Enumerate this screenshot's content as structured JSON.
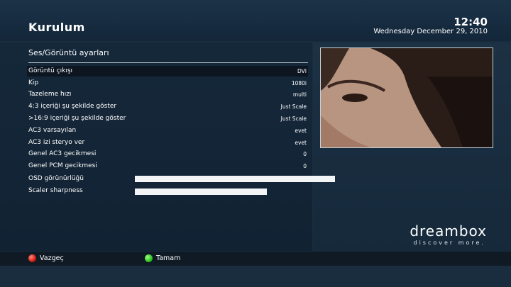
{
  "header": {
    "title": "Kurulum",
    "time": "12:40",
    "date": "Wednesday December 29, 2010"
  },
  "menu": {
    "title": "Ses/Görüntü ayarları",
    "rows": [
      {
        "label": "Görüntü çıkışı",
        "value": "DVI"
      },
      {
        "label": "Kip",
        "value": "1080i"
      },
      {
        "label": "Tazeleme hızı",
        "value": "multi"
      },
      {
        "label": "4:3 içeriği şu şekilde göster",
        "value": "Just Scale"
      },
      {
        "label": ">16:9 içeriği şu şekilde göster",
        "value": "Just Scale"
      },
      {
        "label": "AC3 varsayılan",
        "value": "evet"
      },
      {
        "label": "AC3 izi steryo ver",
        "value": "evet"
      },
      {
        "label": "Genel AC3 gecikmesi",
        "value": "0"
      },
      {
        "label": "Genel PCM gecikmesi",
        "value": "0"
      }
    ],
    "sliders": [
      {
        "label": "OSD görünürlüğü",
        "level": 1.0
      },
      {
        "label": "Scaler sharpness",
        "level": 0.66
      }
    ]
  },
  "logo": {
    "text": "dreambox",
    "tagline": "discover more."
  },
  "footer": {
    "red_label": "Vazgeç",
    "green_label": "Tamam"
  },
  "colors": {
    "background": "#1a2d3e",
    "selected_row": "#0c1520",
    "red_key": "#d31c11",
    "green_key": "#2ec51b"
  }
}
